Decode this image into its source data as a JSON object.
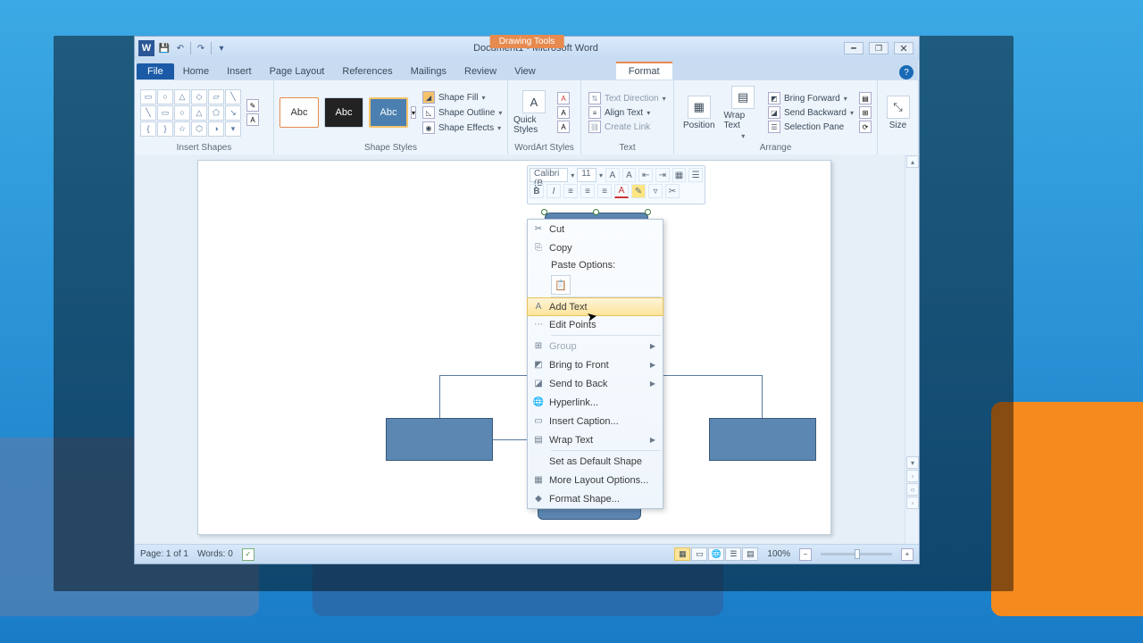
{
  "title": "Document1 - Microsoft Word",
  "contextual_tab": "Drawing Tools",
  "tabs": {
    "file": "File",
    "home": "Home",
    "insert": "Insert",
    "page_layout": "Page Layout",
    "references": "References",
    "mailings": "Mailings",
    "review": "Review",
    "view": "View",
    "format": "Format"
  },
  "ribbon": {
    "insert_shapes": "Insert Shapes",
    "shape_styles": "Shape Styles",
    "wordart_styles": "WordArt Styles",
    "text": "Text",
    "arrange": "Arrange",
    "size": "Size",
    "abc": "Abc",
    "shape_fill": "Shape Fill",
    "shape_outline": "Shape Outline",
    "shape_effects": "Shape Effects",
    "quick_styles": "Quick Styles",
    "text_direction": "Text Direction",
    "align_text": "Align Text",
    "create_link": "Create Link",
    "position": "Position",
    "wrap_text": "Wrap Text",
    "bring_forward": "Bring Forward",
    "send_backward": "Send Backward",
    "selection_pane": "Selection Pane"
  },
  "mini_toolbar": {
    "font": "Calibri (B",
    "size": "11"
  },
  "context_menu": {
    "cut": "Cut",
    "copy": "Copy",
    "paste_options": "Paste Options:",
    "add_text": "Add Text",
    "edit_points": "Edit Points",
    "group": "Group",
    "bring_to_front": "Bring to Front",
    "send_to_back": "Send to Back",
    "hyperlink": "Hyperlink...",
    "insert_caption": "Insert Caption...",
    "wrap_text": "Wrap Text",
    "set_default": "Set as Default Shape",
    "more_layout": "More Layout Options...",
    "format_shape": "Format Shape..."
  },
  "status": {
    "page": "Page: 1 of 1",
    "words": "Words: 0",
    "zoom": "100%"
  }
}
